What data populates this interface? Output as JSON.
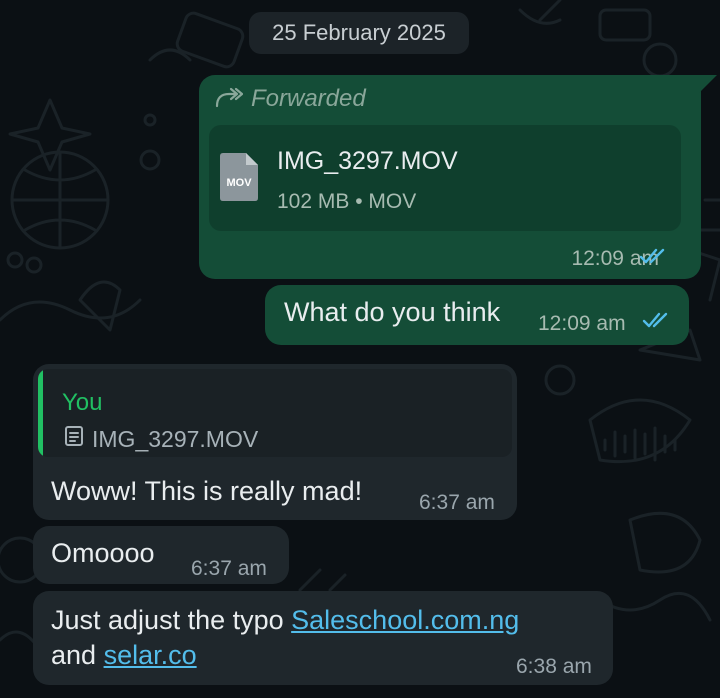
{
  "date_divider": "25 February 2025",
  "messages": {
    "forwarded": {
      "label": "Forwarded",
      "file_badge": "MOV",
      "file_name": "IMG_3297.MOV",
      "file_meta": "102 MB • MOV",
      "time": "12:09 am"
    },
    "what_do_you_think": {
      "text": "What do you think",
      "time": "12:09 am"
    },
    "reply": {
      "quote_author": "You",
      "quote_text": "IMG_3297.MOV",
      "text": "Woww! This is really mad!",
      "time": "6:37 am"
    },
    "omo": {
      "text": "Omoooo",
      "time": "6:37 am"
    },
    "adjust": {
      "text_before": "Just adjust the typo ",
      "link1": "Saleschool.com.ng",
      "text_mid": "and ",
      "link2": "selar.co",
      "time": "6:38 am"
    }
  },
  "colors": {
    "outgoing_bubble": "#144d37",
    "incoming_bubble": "#1f272c",
    "read_ticks": "#53bdeb",
    "link": "#53bdeb",
    "quote_accent": "#21c063"
  },
  "icons": [
    "forward-icon",
    "file-icon",
    "double-check-icon",
    "document-icon"
  ]
}
